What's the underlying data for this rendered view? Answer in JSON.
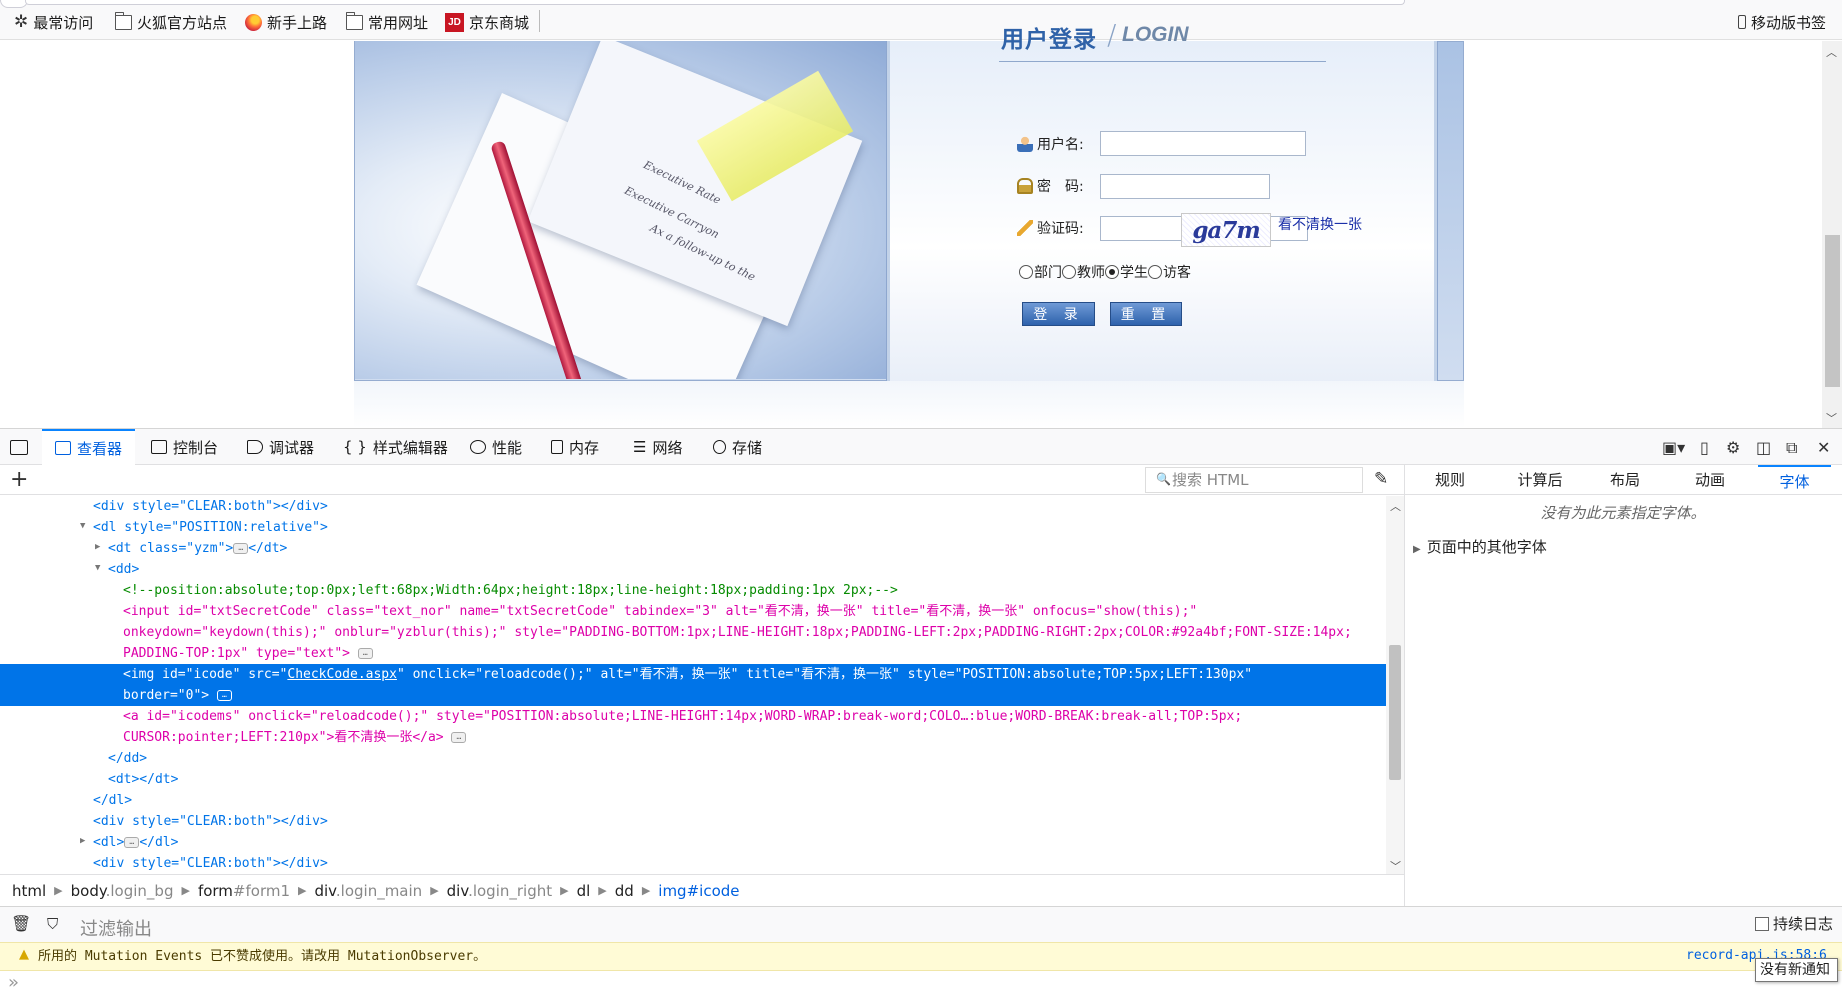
{
  "bookmarks": {
    "items": [
      {
        "label": "最常访问",
        "icon": "gear-icon"
      },
      {
        "label": "火狐官方站点",
        "icon": "folder-icon"
      },
      {
        "label": "新手上路",
        "icon": "firefox-icon"
      },
      {
        "label": "常用网址",
        "icon": "folder-icon"
      },
      {
        "label": "京东商城",
        "icon": "jd-icon"
      }
    ],
    "jd_icon_text": "JD",
    "mobile": "移动版书签"
  },
  "login": {
    "title": "用户登录",
    "title_en": "LOGIN",
    "username_label": "用户名:",
    "password_label": "密　码:",
    "captcha_label": "验证码:",
    "captcha_text": "ga7m",
    "captcha_link": "看不清换一张",
    "roles": [
      "部门",
      "教师",
      "学生",
      "访客"
    ],
    "selected_role": "学生",
    "login_button": "登 录",
    "reset_button": "重 置",
    "paper_text_1": "Executive Rate",
    "paper_text_2": "Executive Carryon",
    "paper_text_3": "Ax a follow-up to the"
  },
  "devtools": {
    "tabs": [
      {
        "label": "查看器",
        "icon": "inspector-icon",
        "active": true
      },
      {
        "label": "控制台",
        "icon": "console-icon"
      },
      {
        "label": "调试器",
        "icon": "debugger-icon"
      },
      {
        "label": "样式编辑器",
        "icon": "style-editor-icon"
      },
      {
        "label": "性能",
        "icon": "performance-icon"
      },
      {
        "label": "内存",
        "icon": "memory-icon"
      },
      {
        "label": "网络",
        "icon": "network-icon"
      },
      {
        "label": "存储",
        "icon": "storage-icon"
      }
    ],
    "search_placeholder": "搜索 HTML",
    "side_tabs": [
      "规则",
      "计算后",
      "布局",
      "动画",
      "字体"
    ],
    "side_active": "字体",
    "no_fonts": "没有为此元素指定字体。",
    "other_fonts": "页面中的其他字体",
    "breadcrumb": [
      {
        "tag": "html",
        "cls": ""
      },
      {
        "tag": "body",
        "cls": ".login_bg"
      },
      {
        "tag": "form",
        "cls": "#form1"
      },
      {
        "tag": "div",
        "cls": ".login_main"
      },
      {
        "tag": "div",
        "cls": ".login_right"
      },
      {
        "tag": "dl",
        "cls": ""
      },
      {
        "tag": "dd",
        "cls": ""
      },
      {
        "tag": "img",
        "cls": "#icode"
      }
    ]
  },
  "markup": {
    "l1": "<div style=\"CLEAR:both\"></div>",
    "l2": "<dl style=\"POSITION:relative\">",
    "l3a": "<dt class=\"yzm\">",
    "l3b": "</dt>",
    "l4": "<dd>",
    "l5": "<!--position:absolute;top:0px;left:68px;Width:64px;height:18px;line-height:18px;padding:1px 2px;-->",
    "l6": "<input id=\"txtSecretCode\" class=\"text_nor\" name=\"txtSecretCode\" tabindex=\"3\" alt=\"看不清，换一张\" title=\"看不清，换一张\" onfocus=\"show(this);\"",
    "l7": "onkeydown=\"keydown(this);\" onblur=\"yzblur(this);\" style=\"PADDING-BOTTOM:1px;LINE-HEIGHT:18px;PADDING-LEFT:2px;PADDING-RIGHT:2px;COLOR:#92a4bf;FONT-SIZE:14px;",
    "l8": "PADDING-TOP:1px\" type=\"text\">",
    "l9a": "<img id=\"icode\" src=\"",
    "l9link": "CheckCode.aspx",
    "l9b": "\" onclick=\"reloadcode();\" alt=\"看不清，换一张\" title=\"看不清，换一张\" style=\"POSITION:absolute;TOP:5px;LEFT:130px\"",
    "l10": "border=\"0\">",
    "l11": "<a id=\"icodems\" onclick=\"reloadcode();\" style=\"POSITION:absolute;LINE-HEIGHT:14px;WORD-WRAP:break-word;COLO…:blue;WORD-BREAK:break-all;TOP:5px;",
    "l12": "CURSOR:pointer;LEFT:210px\">看不清换一张</a>",
    "l13": "</dd>",
    "l14": "<dt></dt>",
    "l15": "</dl>",
    "l16": "<div style=\"CLEAR:both\"></div>",
    "l17a": "<dl>",
    "l17b": "</dl>",
    "l18": "<div style=\"CLEAR:both\"></div>",
    "ellipsis": "…"
  },
  "console": {
    "filter_placeholder": "过滤输出",
    "persist_label": "持续日志",
    "warning": "所用的 Mutation Events 已不赞成使用。请改用 MutationObserver。",
    "warning_source": "record-api.js:58:6",
    "tooltip": "没有新通知"
  }
}
